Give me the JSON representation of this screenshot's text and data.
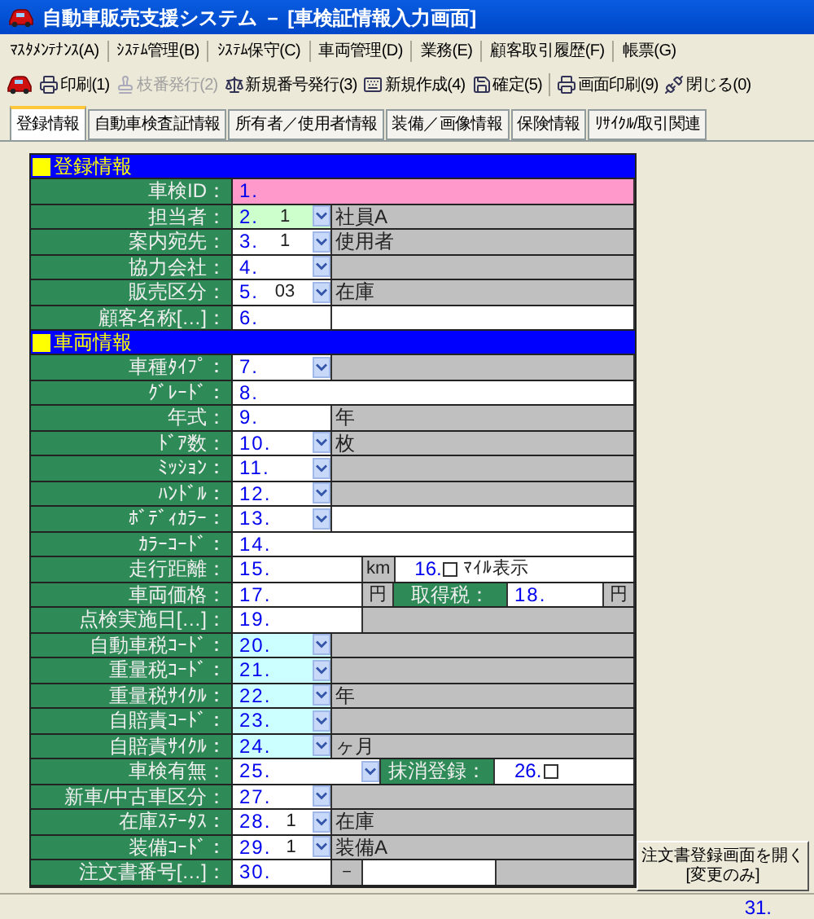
{
  "window": {
    "title": "自動車販売支援システム － [車検証情報入力画面]"
  },
  "menu": [
    "ﾏｽﾀﾒﾝﾃﾅﾝｽ(A)",
    "ｼｽﾃﾑ管理(B)",
    "ｼｽﾃﾑ保守(C)",
    "車両管理(D)",
    "業務(E)",
    "顧客取引履歴(F)",
    "帳票(G)"
  ],
  "toolbar": [
    {
      "items": [
        {
          "label": "印刷(1)",
          "disabled": false
        },
        {
          "label": "枝番発行(2)",
          "disabled": true
        },
        {
          "label": "新規番号発行(3)",
          "disabled": false
        },
        {
          "label": "新規作成(4)",
          "disabled": false
        },
        {
          "label": "確定(5)",
          "disabled": false
        }
      ]
    },
    {
      "items": [
        {
          "label": "画面印刷(9)",
          "disabled": false
        },
        {
          "label": "閉じる(0)",
          "disabled": false
        }
      ]
    }
  ],
  "tabs": [
    {
      "label": "登録情報",
      "selected": true
    },
    {
      "label": "自動車検査証情報",
      "selected": false
    },
    {
      "label": "所有者／使用者情報",
      "selected": false
    },
    {
      "label": "装備／画像情報",
      "selected": false
    },
    {
      "label": "保険情報",
      "selected": false
    },
    {
      "label": "ﾘｻｲｸﾙ/取引関連",
      "selected": false
    }
  ],
  "sections": [
    {
      "title": "登録情報",
      "rows": [
        {
          "label": "車検ID：",
          "cells": [
            {
              "kind": "input_full",
              "number": "1.",
              "color": "#ff99cc"
            }
          ]
        },
        {
          "label": "担当者：",
          "cells": [
            {
              "kind": "select",
              "number": "2.",
              "value": "1",
              "color": "#ccffcc"
            },
            {
              "kind": "note",
              "text": "社員A"
            }
          ]
        },
        {
          "label": "案内宛先：",
          "cells": [
            {
              "kind": "select",
              "number": "3.",
              "value": "1"
            },
            {
              "kind": "note",
              "text": "使用者"
            }
          ]
        },
        {
          "label": "協力会社：",
          "cells": [
            {
              "kind": "select",
              "number": "4."
            },
            {
              "kind": "note"
            }
          ]
        },
        {
          "label": "販売区分：",
          "cells": [
            {
              "kind": "select",
              "number": "5.",
              "value": "03"
            },
            {
              "kind": "note",
              "text": "在庫"
            }
          ]
        },
        {
          "label": "顧客名称[…]：",
          "cells": [
            {
              "kind": "input",
              "number": "6."
            },
            {
              "kind": "blank"
            }
          ]
        }
      ]
    },
    {
      "title": "車両情報",
      "rows": [
        {
          "label": "車種ﾀｲﾌﾟ：",
          "cells": [
            {
              "kind": "select",
              "number": "7."
            },
            {
              "kind": "note"
            }
          ]
        },
        {
          "label": "ｸﾞﾚｰﾄﾞ：",
          "cells": [
            {
              "kind": "input_full",
              "number": "8."
            }
          ]
        },
        {
          "label": "年式：",
          "cells": [
            {
              "kind": "input",
              "number": "9."
            },
            {
              "kind": "note",
              "text": "年"
            }
          ]
        },
        {
          "label": "ﾄﾞｱ数：",
          "cells": [
            {
              "kind": "select",
              "number": "10."
            },
            {
              "kind": "note",
              "text": "枚"
            }
          ]
        },
        {
          "label": "ﾐｯｼｮﾝ：",
          "cells": [
            {
              "kind": "select",
              "number": "11."
            },
            {
              "kind": "note"
            }
          ]
        },
        {
          "label": "ﾊﾝﾄﾞﾙ：",
          "cells": [
            {
              "kind": "select",
              "number": "12."
            },
            {
              "kind": "note"
            }
          ]
        },
        {
          "label": "ﾎﾞﾃﾞｨｶﾗｰ：",
          "cells": [
            {
              "kind": "select",
              "number": "13."
            },
            {
              "kind": "blank"
            }
          ]
        },
        {
          "label": "ｶﾗｰｺｰﾄﾞ：",
          "cells": [
            {
              "kind": "input_full",
              "number": "14."
            }
          ]
        },
        {
          "label": "走行距離：",
          "cells": [
            {
              "kind": "input_long",
              "number": "15."
            },
            {
              "kind": "unit",
              "text": "km"
            },
            {
              "kind": "check",
              "number": "16.",
              "checked": false,
              "text": "ﾏｲﾙ表示"
            }
          ]
        },
        {
          "label": "車両価格：",
          "cells": [
            {
              "kind": "input_long",
              "number": "17."
            },
            {
              "kind": "unit",
              "text": "円"
            },
            {
              "kind": "sublabel",
              "text": "取得税："
            },
            {
              "kind": "input_full",
              "number": "18."
            },
            {
              "kind": "unit",
              "text": "円"
            }
          ]
        },
        {
          "label": "点検実施日[…]：",
          "cells": [
            {
              "kind": "input_long",
              "number": "19."
            },
            {
              "kind": "note"
            }
          ]
        },
        {
          "label": "自動車税ｺｰﾄﾞ：",
          "cells": [
            {
              "kind": "select",
              "number": "20.",
              "color": "#ccffff"
            },
            {
              "kind": "note"
            }
          ]
        },
        {
          "label": "重量税ｺｰﾄﾞ：",
          "cells": [
            {
              "kind": "select",
              "number": "21.",
              "color": "#ccffff"
            },
            {
              "kind": "note"
            }
          ]
        },
        {
          "label": "重量税ｻｲｸﾙ：",
          "cells": [
            {
              "kind": "select",
              "number": "22.",
              "color": "#ccffff"
            },
            {
              "kind": "note",
              "text": "年"
            }
          ]
        },
        {
          "label": "自賠責ｺｰﾄﾞ：",
          "cells": [
            {
              "kind": "select",
              "number": "23.",
              "color": "#ccffff"
            },
            {
              "kind": "note"
            }
          ]
        },
        {
          "label": "自賠責ｻｲｸﾙ：",
          "cells": [
            {
              "kind": "select",
              "number": "24.",
              "color": "#ccffff"
            },
            {
              "kind": "note",
              "text": "ヶ月"
            }
          ]
        },
        {
          "label": "車検有無：",
          "cells": [
            {
              "kind": "select_long",
              "number": "25."
            }
          ],
          "extra": {
            "label": "抹消登録：",
            "number": "26.",
            "checked": false
          }
        },
        {
          "label": "新車/中古車区分：",
          "cells": [
            {
              "kind": "select",
              "number": "27."
            },
            {
              "kind": "note"
            }
          ]
        },
        {
          "label": "在庫ｽﾃｰﾀｽ：",
          "cells": [
            {
              "kind": "select",
              "number": "28.",
              "value": "1"
            },
            {
              "kind": "note",
              "text": "在庫"
            }
          ]
        },
        {
          "label": "装備ｺｰﾄﾞ：",
          "cells": [
            {
              "kind": "select",
              "number": "29.",
              "value": "1"
            },
            {
              "kind": "note",
              "text": "装備A"
            }
          ]
        },
        {
          "label": "注文書番号[…]：",
          "cells": [
            {
              "kind": "input",
              "number": "30."
            },
            {
              "kind": "unit",
              "text": "－"
            },
            {
              "kind": "blank"
            },
            {
              "kind": "note"
            }
          ]
        }
      ]
    }
  ],
  "side_button": {
    "lines": [
      "注文書登録画面を開く",
      "[変更のみ]"
    ]
  },
  "status_bar": {
    "text": "31."
  }
}
